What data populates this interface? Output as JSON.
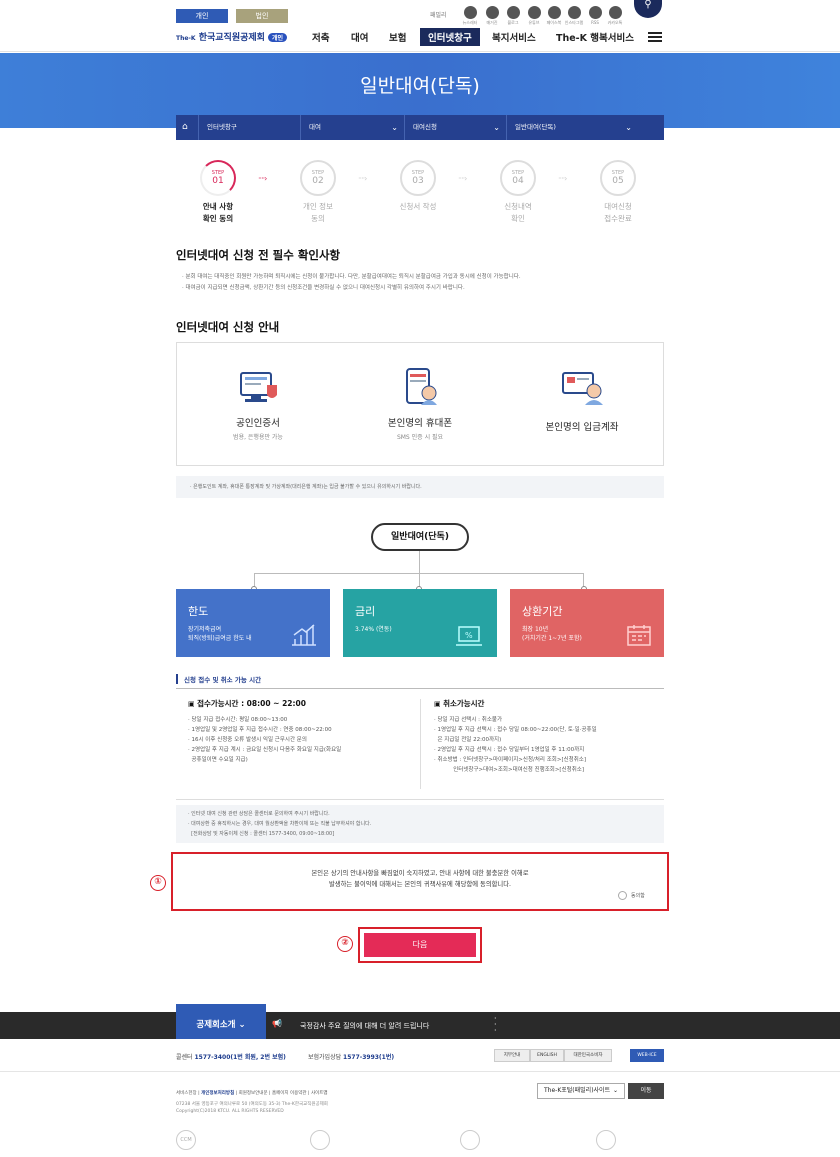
{
  "header": {
    "toggle_personal": "개인",
    "toggle_corporate": "법인",
    "logo_prefix": "The-K",
    "logo_text": "한국교직원공제회",
    "logo_badge": "개인",
    "util_label": "패밀리",
    "sns": [
      "뉴스레터",
      "매거진",
      "블로그",
      "유튜브",
      "페이스북",
      "인스타그램",
      "RSS",
      "카카오톡"
    ],
    "nav": [
      "저축",
      "대여",
      "보험",
      "인터넷창구",
      "복지서비스",
      "The-K 행복서비스"
    ]
  },
  "banner": {
    "title": "일반대여(단독)"
  },
  "breadcrumb": [
    "인터넷창구",
    "대여",
    "대여신청",
    "일반대여(단독)"
  ],
  "steps": [
    {
      "step": "STEP",
      "num": "01",
      "label1": "안내 사항",
      "label2": "확인 동의"
    },
    {
      "step": "STEP",
      "num": "02",
      "label1": "개인 정보",
      "label2": "동의"
    },
    {
      "step": "STEP",
      "num": "03",
      "label1": "신청서 작성",
      "label2": ""
    },
    {
      "step": "STEP",
      "num": "04",
      "label1": "신청내역",
      "label2": "확인"
    },
    {
      "step": "STEP",
      "num": "05",
      "label1": "대여신청",
      "label2": "접수완료"
    }
  ],
  "section1": {
    "title": "인터넷대여 신청 전 필수 확인사항",
    "bullets": [
      "· 분회 대여는 대직중인 회원만 가능하며 퇴직시에는 신청이 불가합니다. 다만, 분할급여대여는 퇴직시 분할급여금 가입과 동시에 신청이 가능합니다.",
      "· 대여금이 지급되면 신청금액, 상환기간 등의 신청조건을 변경하실 수 없으니 대여신청시 각별히 유의하여 주시기 바랍니다."
    ]
  },
  "section2": {
    "title": "인터넷대여 신청 안내",
    "cards": [
      {
        "title": "공인인증서",
        "sub": "범용, 은행용만 가능"
      },
      {
        "title": "본인명의 휴대폰",
        "sub": "SMS 인증 시 필요"
      },
      {
        "title": "본인명의 입금계좌",
        "sub": ""
      }
    ],
    "note": "· 은행도인트 계좌, 휴대폰 통장계좌 및 가상계좌(대리은행 계좌)는 입금 불가할 수 있으니 유의하시기 바랍니다."
  },
  "diagram": {
    "center": "일반대여(단독)",
    "boxes": [
      {
        "title": "한도",
        "d1": "장기저축급여",
        "d2": "퇴직(방퇴)급여금 한도 내",
        "color": "#4472c9"
      },
      {
        "title": "금리",
        "d1": "3.74% (연동)",
        "d2": "",
        "color": "#26a3a3"
      },
      {
        "title": "상환기간",
        "d1": "최장 10년",
        "d2": "(거치기간 1~7년 포함)",
        "color": "#e06464"
      }
    ]
  },
  "schedule": {
    "header": "신청 접수 및 취소 가능 시간",
    "left_title": "접수가능시간 : 08:00 ~ 22:00",
    "left": [
      "· 당일 지급 접수시간: 평일 08:00~13:00",
      "· 1영업일 및 2영업일 후 지급 접수시간 : 연중 08:00~22:00",
      "· 16시 이후 신청중 오류 발생시 익일 근무시간 문의",
      "· 2영업일 후 지급 계시 : 금요일 신청시 다음주 화요일 지급(화요일",
      "  공휴일이면 수요일 지급)"
    ],
    "right_title": "취소가능시간",
    "right": [
      "· 당일 지급 선택시 : 취소불가",
      "· 1영업일 후 지급 선택시 : 접수 당일 08:00~22:00(단, 토·일·공휴일",
      "  은 지급일 전일 22:00까지)",
      "· 2영업일 후 지급 선택시 : 접수 당일부터 1영업일 후 11:00까지",
      "· 취소방법 : 인터넷창구>마이페이지>신청/처리 조회>[신청취소]",
      "           인터넷창구>대여>조회>대여신청 진행조회>[신청취소]"
    ]
  },
  "note2": [
    "· 인터넷 대여 신청 관련 상담은 콜센터로 문의하여 주시기 바랍니다.",
    "· 대여상환 중 휴직하시는 경우, 대여 월상환액을 차환이체 또는 직불 납부하셔야 합니다.",
    "  [전화상담 및 자동이체 신청 : 콜센터 1577-3400, 09:00~18:00]"
  ],
  "agree": {
    "line1": "본인은 상기의 안내사항을 빠짐없이 숙지하였고, 안내 사항에 대한 불충분한 이해로",
    "line2": "발생하는 불이익에 대해서는 본인의 귀책사유에 해당함에 동의합니다.",
    "radio_label": "동의함",
    "marker1": "①",
    "marker2": "②"
  },
  "next_button": "다음",
  "footer": {
    "tab": "공제회소개",
    "tab_arrow": "⌄",
    "notice": "국정감사 주요 질의에 대해 더 알려 드립니다",
    "callcenter_label": "콜센터",
    "callcenter_num": "1577-3400(1번 회원, 2번 보험)",
    "insurance_label": "보험가입상담",
    "insurance_num": "1577-3993(1번)",
    "buttons": [
      "지부안내",
      "ENGLISH",
      "대한민국소비자",
      "WEB-ICE"
    ],
    "links": [
      "서비스헌장",
      "개인정보처리방침",
      "회원정보안내문",
      "홈페이지 이용약관",
      "사이트맵"
    ],
    "address": "07238 서울 영등포구 여의나루로 50 (여의도동 35-3) The-K한국교직원공제회",
    "copyright": "Copyright(C)2018 KTCU. ALL RIGHTS RESERVED",
    "family_select": "The-K포털(패밀리)사이트",
    "go": "이동",
    "certs": [
      "CCM",
      "",
      "",
      ""
    ]
  },
  "colors": {
    "primary": "#25408f",
    "accent": "#e42b57",
    "marker": "#d8202a"
  }
}
